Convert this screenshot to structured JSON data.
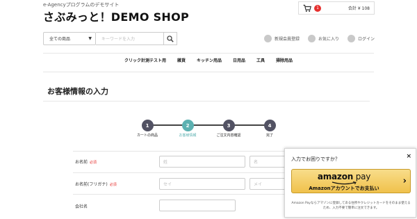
{
  "header": {
    "tagline": "e-Agencyプログラムのデモサイト",
    "title": "さぶみっと！DEMO SHOP",
    "cart_count": "1",
    "cart_total": "合計 ¥ 108"
  },
  "search": {
    "category_selected": "全ての商品",
    "placeholder": "キーワードを入力"
  },
  "user_links": [
    {
      "label": "新規会員登録",
      "icon": "user-add-icon"
    },
    {
      "label": "お気に入り",
      "icon": "heart-icon"
    },
    {
      "label": "ログイン",
      "icon": "lock-icon"
    }
  ],
  "nav": [
    "クリック計測テスト用",
    "雑貨",
    "キッチン用品",
    "日用品",
    "工具",
    "掃除用品"
  ],
  "page": {
    "title": "お客様情報の入力"
  },
  "steps": [
    {
      "num": "1",
      "label": "カートの商品",
      "active": false
    },
    {
      "num": "2",
      "label": "お客様情報",
      "active": true
    },
    {
      "num": "3",
      "label": "ご注文内容確認",
      "active": false
    },
    {
      "num": "4",
      "label": "完了",
      "active": false
    }
  ],
  "form": {
    "required_badge": "必須",
    "name_label": "お名前",
    "last_name_placeholder": "姓",
    "first_name_placeholder": "名",
    "kana_label": "お名前(フリガナ)",
    "kana_last_placeholder": "セイ",
    "kana_first_placeholder": "メイ",
    "company_label": "会社名"
  },
  "popup": {
    "title": "入力でお困りですか？",
    "close": "×",
    "button_logo_main": "amazon",
    "button_logo_pay": " pay",
    "button_sub": "Amazonアカウントでお支払い",
    "button_arrow": "›",
    "note": "Amazon Payならアマゾンに登録してある住所やクレジットカードをそのまま使えるため、入力不要で簡単に注文できます。"
  },
  "colors": {
    "accent": "#5cb1b1",
    "step_default": "#525263",
    "required": "#e6302e",
    "amazon_button": "#f0c14b"
  }
}
